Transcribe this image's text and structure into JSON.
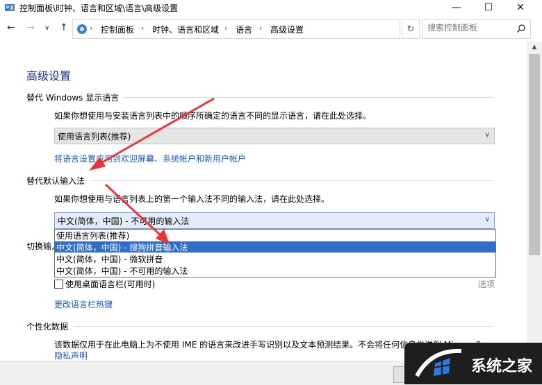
{
  "window": {
    "title": "控制面板\\时钟、语言和区域\\语言\\高级设置",
    "min_glyph": "—",
    "max_glyph": "☐",
    "close_glyph": "✕"
  },
  "nav": {
    "back_glyph": "←",
    "forward_glyph": "→",
    "history_glyph": "∨",
    "up_glyph": "↑",
    "breadcrumbs": [
      "控制面板",
      "时钟、语言和区域",
      "语言",
      "高级设置"
    ],
    "refresh_glyph": "↻",
    "search_placeholder": "搜索控制面板"
  },
  "main": {
    "title": "高级设置",
    "display_lang": {
      "heading": "替代 Windows 显示语言",
      "desc": "如果你想使用与安装语言列表中的顺序所确定的语言不同的显示语言，请在此处选择。",
      "select_value": "使用语言列表(推荐)",
      "link": "将语言设置应用到欢迎屏幕、系统帐户和新用户帐户"
    },
    "input_method": {
      "heading": "替代默认输入法",
      "desc": "如果你想使用与语言列表上的第一个输入法不同的输入法，请在此处选择。",
      "select_value": "中文(简体，中国) - 不可用的输入法",
      "options": [
        "使用语言列表(推荐)",
        "中文(简体，中国) - 搜狗拼音输入法",
        "中文(简体，中国) - 微软拼音",
        "中文(简体，中国) - 不可用的输入法"
      ],
      "selected_index": 1
    },
    "switch_label": "切换输入",
    "desktop_bar_label": "使用桌面语言栏(可用时)",
    "options_link": "选项",
    "hotkey_link": "更改语言栏热键",
    "personalization": {
      "heading": "个性化数据",
      "desc": "该数据仅用于在此电脑上为不使用 IME 的语言来改进手写识别以及文本预测结果。不会将任何信息发送到 Microsoft",
      "privacy_link": "隐私声明"
    }
  },
  "watermark": {
    "text": "系统之家"
  },
  "colors": {
    "accent": "#2f6ec9",
    "link": "#1a56c8",
    "title": "#1e3287",
    "arrow": "#e8363b"
  }
}
